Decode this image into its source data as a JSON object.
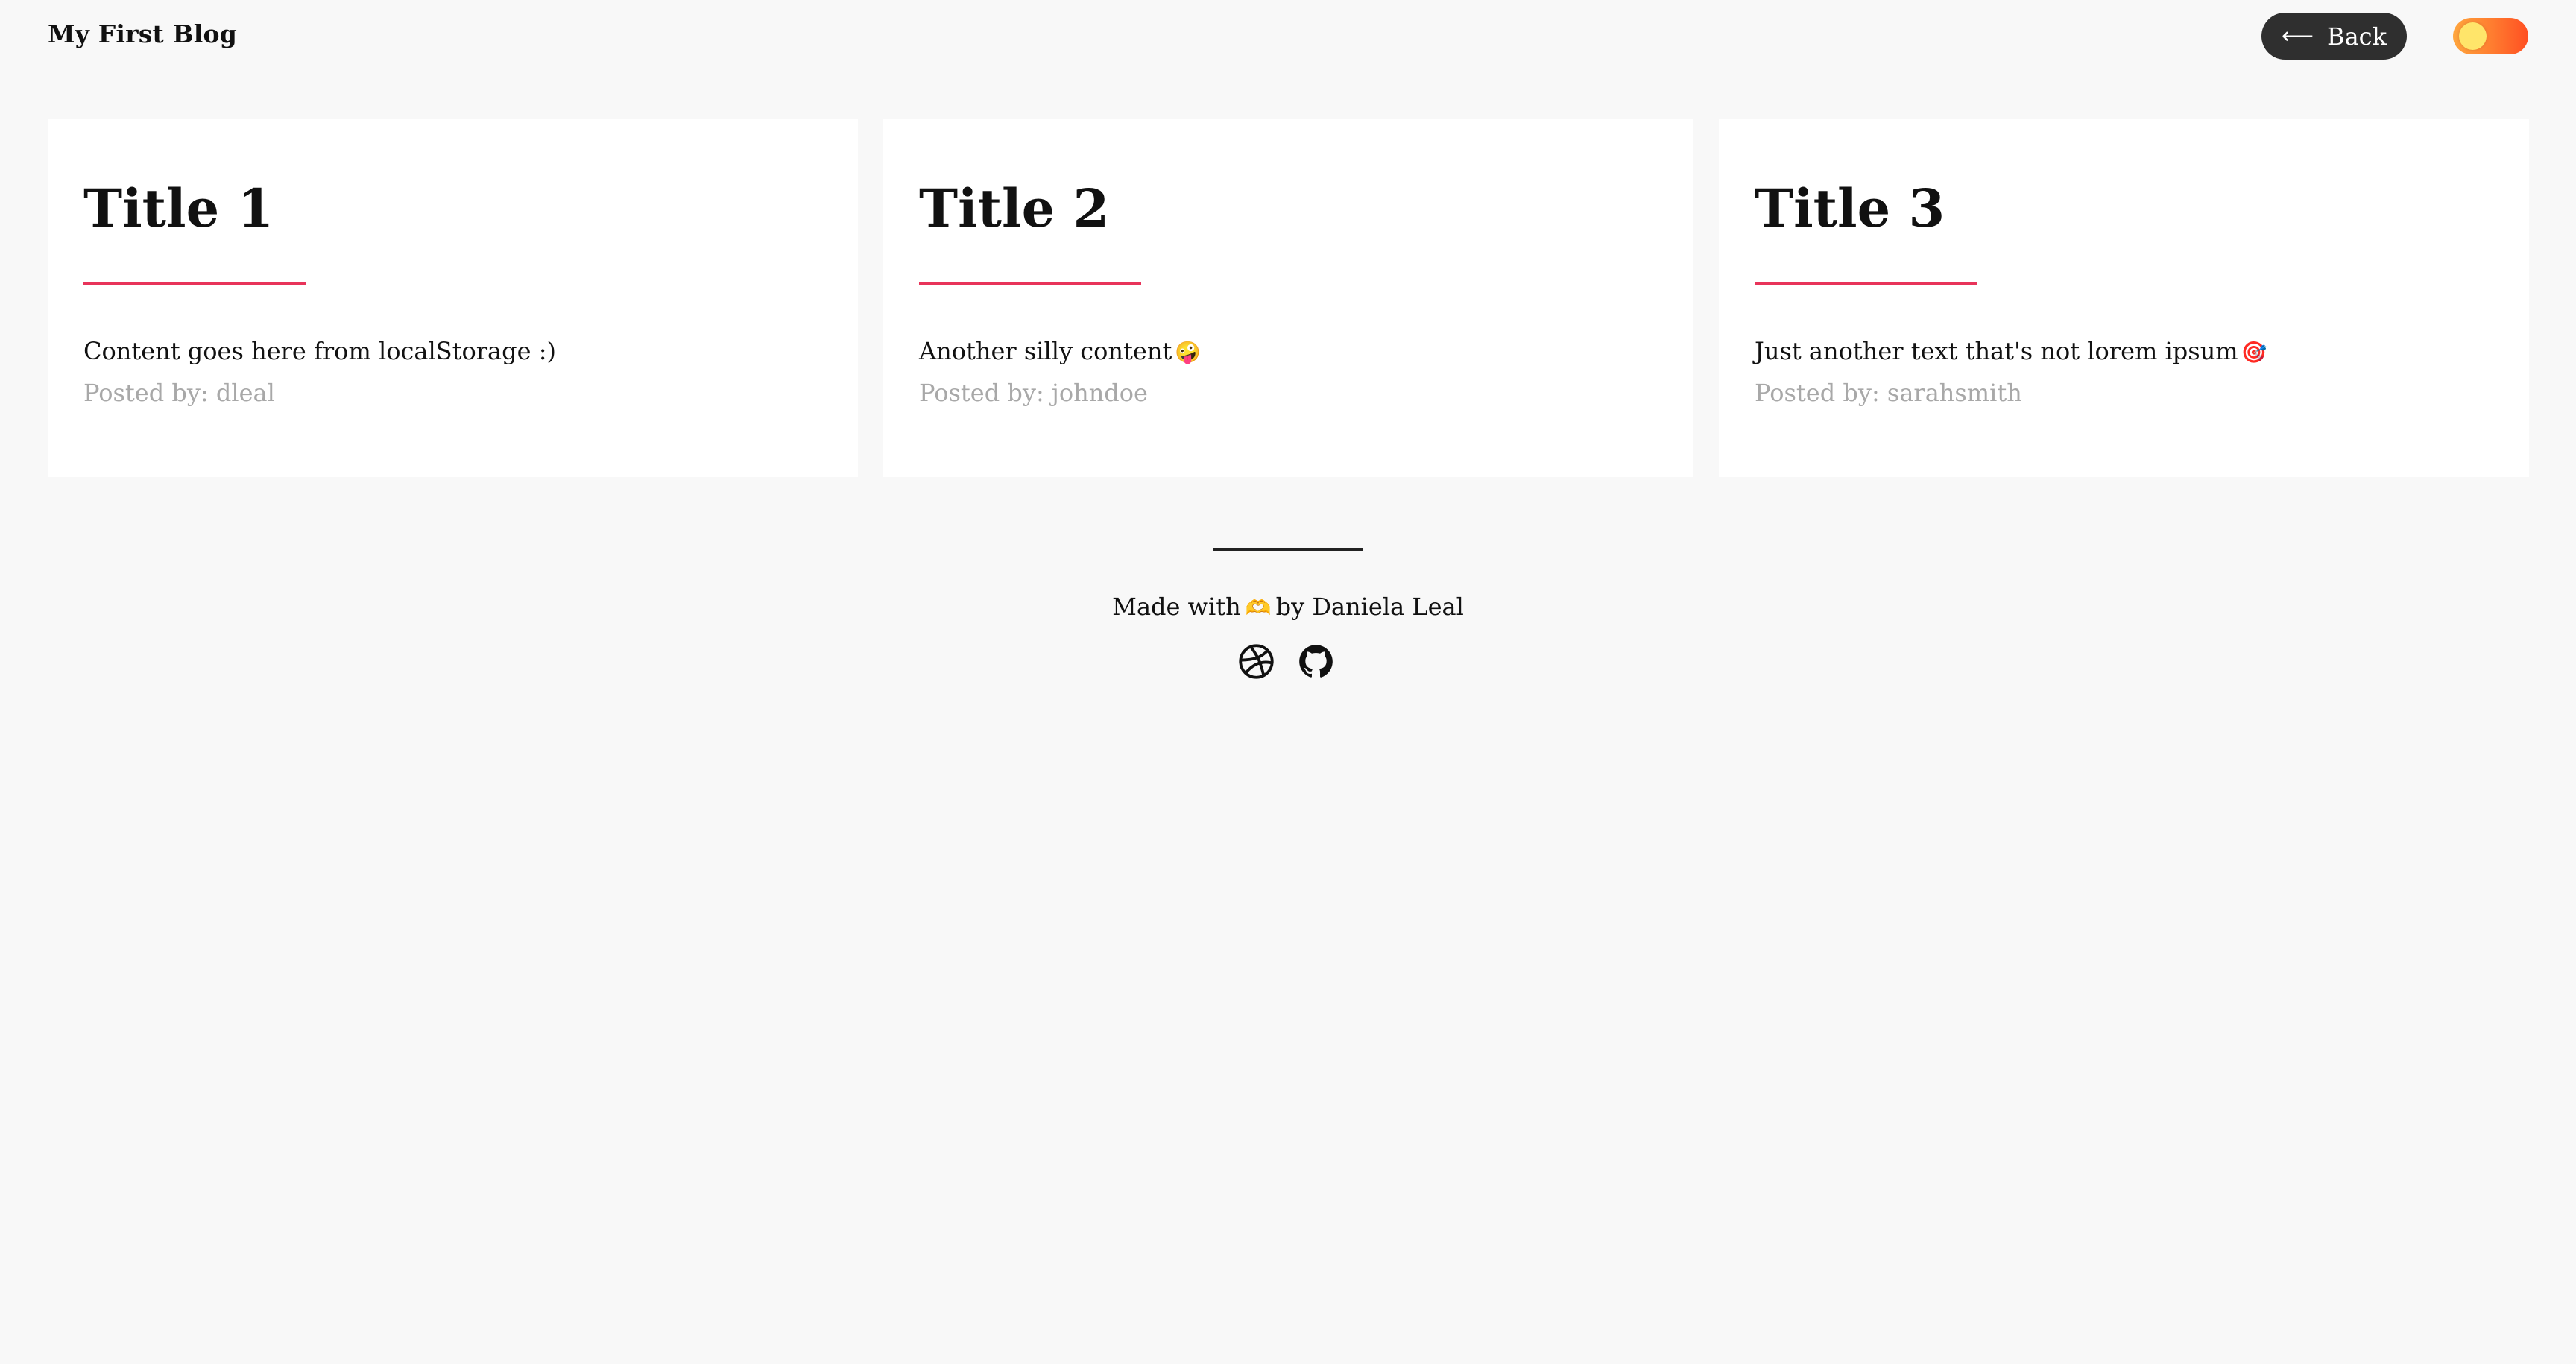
{
  "header": {
    "brand": "My First Blog",
    "back_label": "Back",
    "back_arrow": "⟵"
  },
  "theme_toggle": {
    "state": "light",
    "gradient_colors": [
      "#ffa63d",
      "#ff4f22"
    ],
    "knob_color": "#ffe56a"
  },
  "posts": [
    {
      "title": "Title 1",
      "content": "Content goes here from localStorage :)",
      "emoji": "",
      "author_line": "Posted by: dleal"
    },
    {
      "title": "Title 2",
      "content": "Another silly content",
      "emoji": "🤪",
      "author_line": "Posted by: johndoe"
    },
    {
      "title": "Title 3",
      "content": "Just another text that's not lorem ipsum",
      "emoji": "🎯",
      "author_line": "Posted by: sarahsmith"
    }
  ],
  "footer": {
    "made_with": "Made with",
    "heart": "🫶",
    "by": "by Daniela Leal",
    "social_icons": [
      "dribbble-icon",
      "github-icon"
    ]
  },
  "colors": {
    "accent_rule": "#e8345a",
    "background": "#f8f8f8",
    "author_text": "#a8a8a8",
    "back_button_bg": "#2f2f2f"
  }
}
